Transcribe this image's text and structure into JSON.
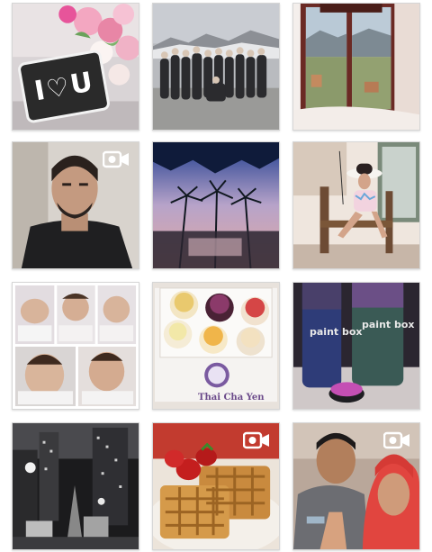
{
  "grid": {
    "tiles": [
      {
        "id": "tile-1",
        "subject": "i-love-you-sign-with-roses",
        "video": false
      },
      {
        "id": "tile-2",
        "subject": "group-photo-in-mountains",
        "video": false
      },
      {
        "id": "tile-3",
        "subject": "window-view-of-valley",
        "video": false
      },
      {
        "id": "tile-4",
        "subject": "selfie-in-car",
        "video": true
      },
      {
        "id": "tile-5",
        "subject": "palm-trees-at-sunset",
        "video": false
      },
      {
        "id": "tile-6",
        "subject": "woman-in-hat-on-chair",
        "video": false
      },
      {
        "id": "tile-7",
        "subject": "baby-photo-collage",
        "video": false
      },
      {
        "id": "tile-8",
        "subject": "cupcake-box",
        "video": false
      },
      {
        "id": "tile-9",
        "subject": "paint-box-products",
        "video": false
      },
      {
        "id": "tile-10",
        "subject": "city-at-night",
        "video": false
      },
      {
        "id": "tile-11",
        "subject": "waffles-with-strawberries",
        "video": true
      },
      {
        "id": "tile-12",
        "subject": "couple-selfie",
        "video": true
      }
    ]
  },
  "texts": {
    "sign_left": "I",
    "sign_right": "U",
    "paint_box_1": "paint box",
    "paint_box_2": "paint box",
    "cupcake_brand": "Thai Cha Yen"
  },
  "colors": {
    "tile_border": "#d6d6d6",
    "video_icon": "#ffffff"
  },
  "icons": {
    "video": "video-camera-icon"
  }
}
